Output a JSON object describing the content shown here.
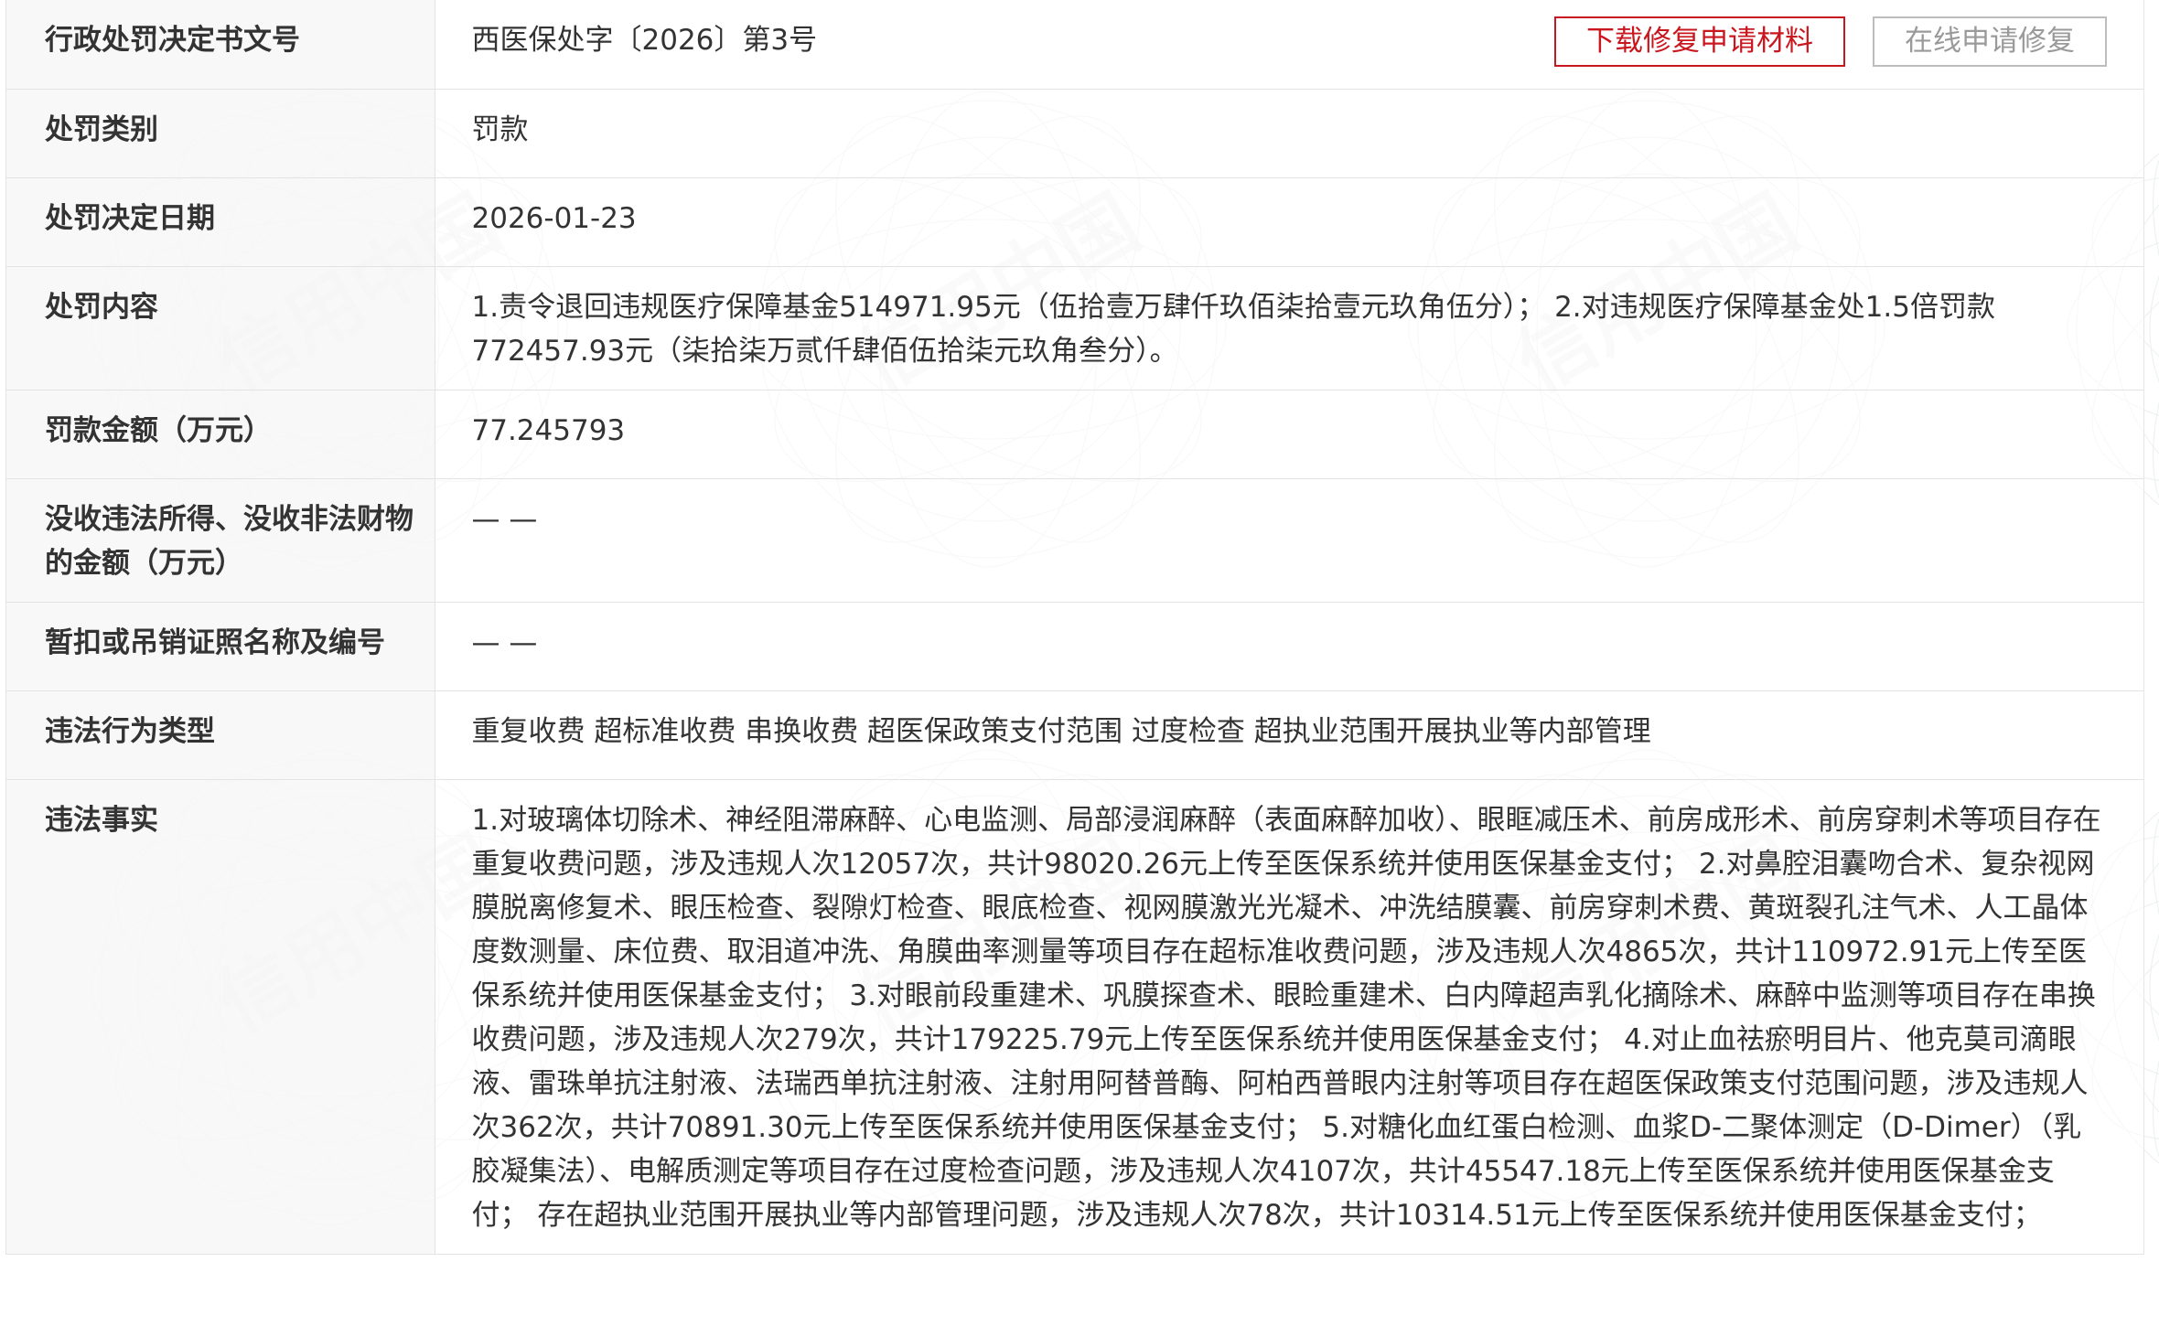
{
  "actions": {
    "download_label": "下载修复申请材料",
    "online_label": "在线申请修复"
  },
  "colors": {
    "accent": "#c9171f",
    "label_bg": "#f6f6f6",
    "border": "#e3e3e3",
    "text": "#333333"
  },
  "watermark": {
    "text": "信用中国"
  },
  "rows": [
    {
      "label": "行政处罚决定书文号",
      "value": "西医保处字〔2026〕第3号"
    },
    {
      "label": "处罚类别",
      "value": "罚款"
    },
    {
      "label": "处罚决定日期",
      "value": "2026-01-23"
    },
    {
      "label": "处罚内容",
      "value": "1.责令退回违规医疗保障基金514971.95元（伍拾壹万肆仟玖佰柒拾壹元玖角伍分）； 2.对违规医疗保障基金处1.5倍罚款772457.93元（柒拾柒万贰仟肆佰伍拾柒元玖角叁分）。"
    },
    {
      "label": "罚款金额（万元）",
      "value": "77.245793"
    },
    {
      "label": "没收违法所得、没收非法财物的金额（万元）",
      "value": "— —"
    },
    {
      "label": "暂扣或吊销证照名称及编号",
      "value": "— —"
    },
    {
      "label": "违法行为类型",
      "value": "重复收费 超标准收费 串换收费 超医保政策支付范围 过度检查 超执业范围开展执业等内部管理"
    },
    {
      "label": "违法事实",
      "value": "1.对玻璃体切除术、神经阻滞麻醉、心电监测、局部浸润麻醉（表面麻醉加收）、眼眶减压术、前房成形术、前房穿刺术等项目存在重复收费问题，涉及违规人次12057次，共计98020.26元上传至医保系统并使用医保基金支付； 2.对鼻腔泪囊吻合术、复杂视网膜脱离修复术、眼压检查、裂隙灯检查、眼底检查、视网膜激光光凝术、冲洗结膜囊、前房穿刺术费、黄斑裂孔注气术、人工晶体度数测量、床位费、取泪道冲洗、角膜曲率测量等项目存在超标准收费问题，涉及违规人次4865次，共计110972.91元上传至医保系统并使用医保基金支付； 3.对眼前段重建术、巩膜探查术、眼睑重建术、白内障超声乳化摘除术、麻醉中监测等项目存在串换收费问题，涉及违规人次279次，共计179225.79元上传至医保系统并使用医保基金支付； 4.对止血祛瘀明目片、他克莫司滴眼液、雷珠单抗注射液、法瑞西单抗注射液、注射用阿替普酶、阿柏西普眼内注射等项目存在超医保政策支付范围问题，涉及违规人次362次，共计70891.30元上传至医保系统并使用医保基金支付； 5.对糖化血红蛋白检测、血浆D-二聚体测定（D-Dimer）（乳胶凝集法）、电解质测定等项目存在过度检查问题，涉及违规人次4107次，共计45547.18元上传至医保系统并使用医保基金支付； 存在超执业范围开展执业等内部管理问题，涉及违规人次78次，共计10314.51元上传至医保系统并使用医保基金支付；"
    }
  ]
}
